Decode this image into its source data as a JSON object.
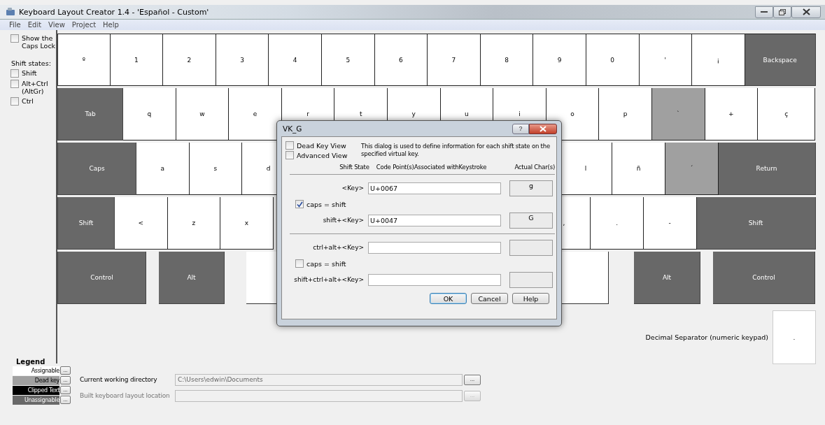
{
  "window": {
    "title": "Keyboard Layout Creator 1.4 - 'Español - Custom'"
  },
  "menu": [
    "File",
    "Edit",
    "View",
    "Project",
    "Help"
  ],
  "options": {
    "caps_lock": {
      "label": "Show the Caps Lock",
      "checked": false
    },
    "shift_states_label": "Shift states:",
    "shift_states": [
      {
        "label": "Shift",
        "checked": false
      },
      {
        "label": "Alt+Ctrl (AltGr)",
        "checked": false
      },
      {
        "label": "Ctrl",
        "checked": false
      }
    ]
  },
  "keyboard": {
    "rows": [
      [
        {
          "label": "º",
          "kind": "char"
        },
        {
          "label": "1",
          "kind": "char"
        },
        {
          "label": "2",
          "kind": "char"
        },
        {
          "label": "3",
          "kind": "char"
        },
        {
          "label": "4",
          "kind": "char"
        },
        {
          "label": "5",
          "kind": "char"
        },
        {
          "label": "6",
          "kind": "char"
        },
        {
          "label": "7",
          "kind": "char"
        },
        {
          "label": "8",
          "kind": "char"
        },
        {
          "label": "9",
          "kind": "char"
        },
        {
          "label": "0",
          "kind": "char"
        },
        {
          "label": "'",
          "kind": "char"
        },
        {
          "label": "¡",
          "kind": "char"
        },
        {
          "label": "Backspace",
          "kind": "function"
        }
      ],
      [
        {
          "label": "Tab",
          "kind": "function"
        },
        {
          "label": "q",
          "kind": "char"
        },
        {
          "label": "w",
          "kind": "char"
        },
        {
          "label": "e",
          "kind": "char"
        },
        {
          "label": "r",
          "kind": "char"
        },
        {
          "label": "t",
          "kind": "char"
        },
        {
          "label": "y",
          "kind": "char"
        },
        {
          "label": "u",
          "kind": "char"
        },
        {
          "label": "i",
          "kind": "char"
        },
        {
          "label": "o",
          "kind": "char"
        },
        {
          "label": "p",
          "kind": "char"
        },
        {
          "label": "`",
          "kind": "dead"
        },
        {
          "label": "+",
          "kind": "char"
        },
        {
          "label": "ç",
          "kind": "char"
        }
      ],
      [
        {
          "label": "Caps",
          "kind": "function"
        },
        {
          "label": "a",
          "kind": "char"
        },
        {
          "label": "s",
          "kind": "char"
        },
        {
          "label": "d",
          "kind": "char"
        },
        {
          "kind": "covered"
        },
        {
          "kind": "covered"
        },
        {
          "kind": "covered"
        },
        {
          "kind": "covered"
        },
        {
          "kind": "covered"
        },
        {
          "label": "l",
          "kind": "char"
        },
        {
          "label": "ñ",
          "kind": "char"
        },
        {
          "label": "´",
          "kind": "dead"
        },
        {
          "label": "Return",
          "kind": "function"
        }
      ],
      [
        {
          "label": "Shift",
          "kind": "function"
        },
        {
          "label": "<",
          "kind": "char"
        },
        {
          "label": "z",
          "kind": "char"
        },
        {
          "label": "x",
          "kind": "char"
        },
        {
          "kind": "covered"
        },
        {
          "kind": "covered"
        },
        {
          "kind": "covered"
        },
        {
          "kind": "covered"
        },
        {
          "kind": "covered"
        },
        {
          "label": ",",
          "kind": "char"
        },
        {
          "label": ".",
          "kind": "char"
        },
        {
          "label": "-",
          "kind": "char"
        },
        {
          "label": "Shift",
          "kind": "function"
        }
      ],
      [
        {
          "label": "Control",
          "kind": "function"
        },
        {
          "label": "Alt",
          "kind": "function"
        },
        {
          "kind": "space"
        },
        {
          "label": "Alt",
          "kind": "function"
        },
        {
          "label": "Control",
          "kind": "function"
        }
      ]
    ],
    "decimal_separator": {
      "label": "Decimal Separator (numeric keypad)",
      "key": "."
    }
  },
  "dialog": {
    "title": "VK_G",
    "help": "?",
    "views": [
      {
        "label": "Dead Key View",
        "checked": false
      },
      {
        "label": "Advanced View",
        "checked": false
      }
    ],
    "description": "This dialog is used to define information for each shift state on the specified virtual key.",
    "columns": [
      "Shift State",
      "Code Point(s)Associated withKeystroke",
      "Actual Char(s)"
    ],
    "groups": [
      {
        "rows": [
          {
            "state": "<Key>",
            "code": "U+0067",
            "char": "g"
          },
          {
            "state": "shift+<Key>",
            "code": "U+0047",
            "char": "G"
          }
        ],
        "caps_label": "caps = shift",
        "caps_checked": true
      },
      {
        "rows": [
          {
            "state": "ctrl+alt+<Key>"
          },
          {
            "state": "shift+ctrl+alt+<Key>"
          }
        ],
        "caps_label": "caps = shift",
        "caps_checked": false
      }
    ],
    "buttons": [
      {
        "label": "OK",
        "default": true
      },
      {
        "label": "Cancel",
        "default": false
      },
      {
        "label": "Help",
        "default": false
      }
    ]
  },
  "legend": {
    "title": "Legend",
    "items": [
      {
        "label": "Assignable",
        "color": "#ffffff"
      },
      {
        "label": "Dead key",
        "color": "#a0a0a0"
      },
      {
        "label": "Clipped Text",
        "color": "#000000"
      },
      {
        "label": "Unassignable",
        "color": "#696969"
      }
    ],
    "button": "..."
  },
  "paths": [
    {
      "label": "Current working directory",
      "value": "C:\\Users\\edwin\\Documents",
      "disabled": false,
      "button": "..."
    },
    {
      "label": "Built keyboard layout location",
      "disabled": true,
      "button": "..."
    }
  ]
}
